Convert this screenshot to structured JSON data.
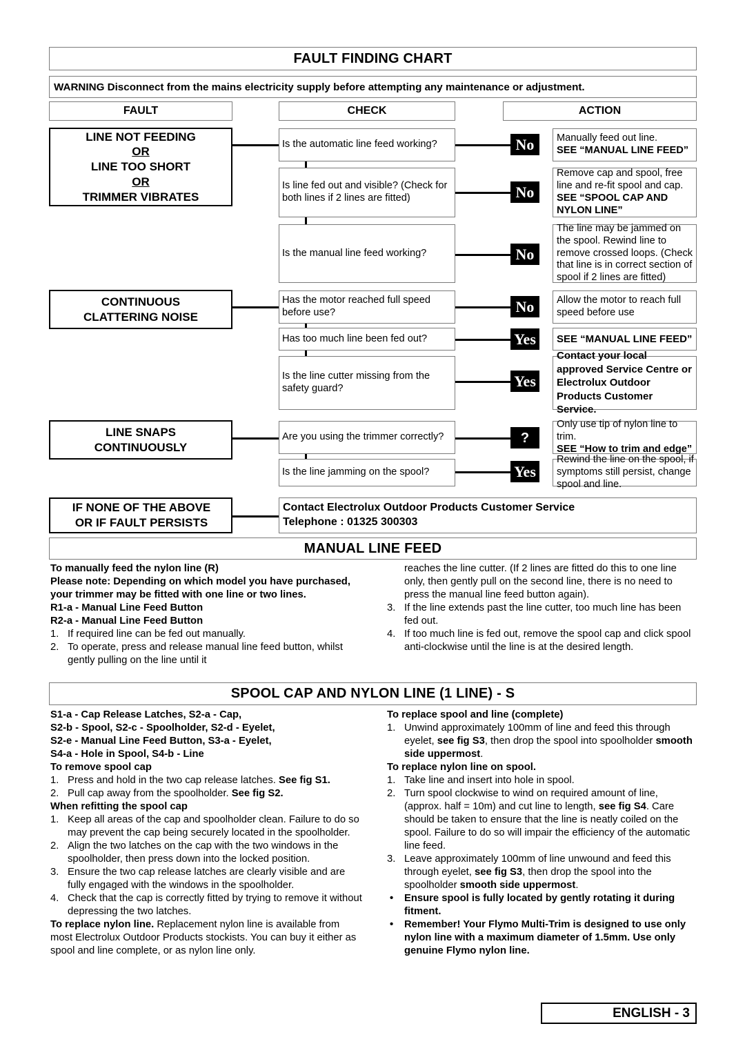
{
  "fault_chart": {
    "title": "FAULT FINDING CHART",
    "warning": "WARNING Disconnect from the mains electricity supply before attempting any maintenance or adjustment.",
    "columns": {
      "fault": "FAULT",
      "check": "CHECK",
      "action": "ACTION"
    },
    "groups": [
      {
        "fault_lines": [
          "LINE NOT FEEDING",
          "OR",
          "LINE TOO SHORT",
          "OR",
          "TRIMMER VIBRATES"
        ],
        "rows": [
          {
            "check": "Is the automatic line feed working?",
            "badge": "No",
            "action_plain": "Manually feed out line.",
            "action_bold": "SEE “MANUAL LINE FEED”"
          },
          {
            "check": "Is line fed out and visible? (Check for both lines if 2 lines are fitted)",
            "badge": "No",
            "action_plain": "Remove cap and spool, free line and re-fit spool and cap.",
            "action_bold": "SEE “SPOOL CAP AND NYLON LINE”"
          },
          {
            "check": "Is the manual line feed working?",
            "badge": "No",
            "action_plain": "The line may be jammed on the spool. Rewind line to remove crossed loops. (Check that line is in correct section of spool if 2 lines are fitted)",
            "action_bold": ""
          }
        ]
      },
      {
        "fault_lines": [
          "CONTINUOUS",
          "CLATTERING NOISE"
        ],
        "rows": [
          {
            "check": "Has the motor reached full speed before use?",
            "badge": "No",
            "action_plain": "Allow the motor to reach full speed before use",
            "action_bold": ""
          },
          {
            "check": "Has too much line been fed out?",
            "badge": "Yes",
            "action_plain": "",
            "action_bold": "SEE “MANUAL LINE FEED”"
          },
          {
            "check": "Is the line cutter missing from the safety guard?",
            "badge": "Yes",
            "action_plain": "",
            "action_bold": "Contact your local approved Service Centre or Electrolux Outdoor Products Customer Service."
          }
        ]
      },
      {
        "fault_lines": [
          "LINE SNAPS",
          "CONTINUOUSLY"
        ],
        "rows": [
          {
            "check": "Are you using the trimmer correctly?",
            "badge": "?",
            "action_plain": "Only use tip of nylon line to trim.",
            "action_bold": "SEE “How to trim and edge”"
          },
          {
            "check": "Is the line jamming on the spool?",
            "badge": "Yes",
            "action_plain": "Rewind the line on the spool, if symptoms still persist, change spool and line.",
            "action_bold": ""
          }
        ]
      }
    ],
    "final": {
      "fault_lines": [
        "IF NONE OF THE ABOVE",
        "OR IF FAULT PERSISTS"
      ],
      "action_line1": "Contact Electrolux Outdoor Products Customer Service",
      "action_line2": "Telephone : 01325 300303"
    }
  },
  "manual_line_feed": {
    "title": "MANUAL LINE FEED",
    "left": [
      {
        "type": "hd",
        "text": "To manually feed the nylon line (R)"
      },
      {
        "type": "hd",
        "text": "Please note: Depending on which model you have purchased, your trimmer may be fitted with one line or two lines."
      },
      {
        "type": "hd",
        "text": "R1-a - Manual Line Feed Button"
      },
      {
        "type": "hd",
        "text": "R2-a - Manual Line Feed Button"
      },
      {
        "type": "li",
        "num": "1.",
        "text": "If required line can be fed out manually."
      },
      {
        "type": "li",
        "num": "2.",
        "text": "To operate, press and release manual line feed button, whilst gently pulling on the line until it"
      }
    ],
    "right": [
      {
        "type": "cont",
        "text": "reaches the line cutter. (If 2 lines are fitted do this to one line only, then gently pull on the second line, there is no need to press the manual line feed button again)."
      },
      {
        "type": "li",
        "num": "3.",
        "text": "If the line extends past the line cutter, too much line has been fed out."
      },
      {
        "type": "li",
        "num": "4.",
        "text": "If too much line is fed out, remove the spool cap and click spool anti-clockwise until the line is at the desired length."
      }
    ]
  },
  "spool_cap": {
    "title": "SPOOL CAP AND NYLON LINE (1 LINE) - S",
    "legend": [
      "S1-a - Cap Release Latches,  S2-a - Cap,",
      "S2-b - Spool,  S2-c - Spoolholder,  S2-d - Eyelet,",
      "S2-e - Manual Line Feed Button,  S3-a - Eyelet,",
      "S4-a - Hole in Spool,  S4-b - Line"
    ],
    "left": {
      "h1": "To remove spool cap",
      "items1": [
        {
          "num": "1.",
          "pre": "Press and hold in the two cap release latches. ",
          "bold": "See fig S1.",
          "post": ""
        },
        {
          "num": "2.",
          "pre": "Pull cap away from the spoolholder. ",
          "bold": "See fig S2.",
          "post": ""
        }
      ],
      "h2": "When refitting the spool cap",
      "items2": [
        {
          "num": "1.",
          "pre": "Keep all areas of the cap and spoolholder clean. Failure to do so may prevent the cap being securely located in the spoolholder.",
          "bold": "",
          "post": ""
        },
        {
          "num": "2.",
          "pre": "Align the two latches on the cap with the two windows in the spoolholder, then press down into the locked position.",
          "bold": "",
          "post": ""
        },
        {
          "num": "3.",
          "pre": "Ensure the two cap release latches are clearly visible and are fully engaged with the windows in the spoolholder.",
          "bold": "",
          "post": ""
        },
        {
          "num": "4.",
          "pre": "Check that the cap is correctly fitted by trying to remove it without depressing the two latches.",
          "bold": "",
          "post": ""
        }
      ],
      "closing_bold": "To replace nylon line.",
      "closing_text": "  Replacement nylon line is available from most Electrolux Outdoor Products stockists.  You can buy it either as spool and line complete, or as nylon line only."
    },
    "right": {
      "h1": "To replace spool and line (complete)",
      "items1": [
        {
          "num": "1.",
          "p1": "Unwind approximately 100mm of line and feed this through eyelet, ",
          "b1": "see fig S3",
          "p2": ", then drop the spool into spoolholder ",
          "b2": "smooth side uppermost",
          "p3": "."
        }
      ],
      "h2": "To replace nylon line on spool.",
      "items2": [
        {
          "num": "1.",
          "p1": "Take line and insert into hole in spool.",
          "b1": "",
          "p2": "",
          "b2": "",
          "p3": ""
        },
        {
          "num": "2.",
          "p1": "Turn spool clockwise to wind on required amount of line, (approx. half = 10m) and cut line to length, ",
          "b1": "see fig S4",
          "p2": ".  Care should be taken to ensure that the line is neatly coiled on the spool.  Failure to do so will impair the efficiency of the automatic line feed.",
          "b2": "",
          "p3": ""
        },
        {
          "num": "3.",
          "p1": "Leave approximately 100mm of line unwound and feed this through eyelet, ",
          "b1": "see fig S3",
          "p2": ", then drop the spool into the spoolholder ",
          "b2": "smooth side uppermost",
          "p3": "."
        }
      ],
      "bullets": [
        "Ensure spool is fully located by gently rotating it during fitment.",
        "Remember! Your Flymo Multi-Trim is designed to use only nylon line with a maximum diameter of 1.5mm.  Use only genuine Flymo nylon line."
      ],
      "bullet_char": "•"
    }
  },
  "footer": {
    "label": "ENGLISH - 3"
  }
}
